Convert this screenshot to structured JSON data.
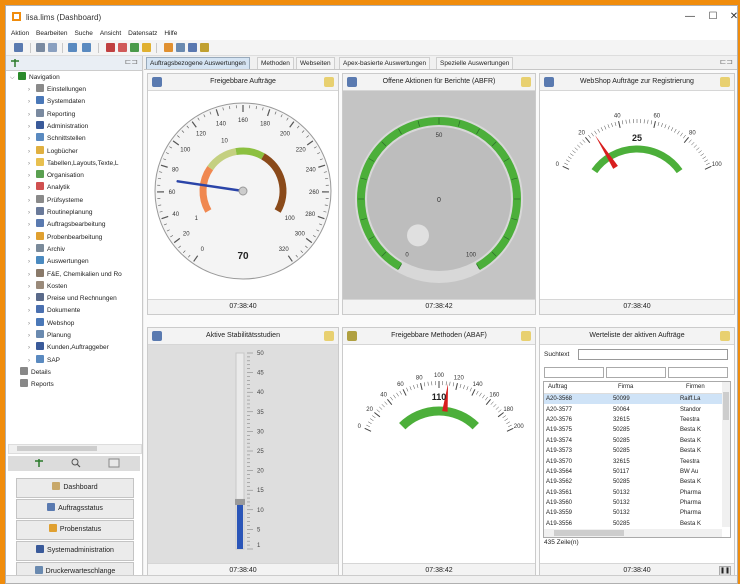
{
  "window": {
    "title": "lisa.lims (Dashboard)",
    "minimize": "—",
    "maximize": "☐",
    "close": "✕"
  },
  "menu": [
    "Aktion",
    "Bearbeiten",
    "Suche",
    "Ansicht",
    "Datensatz",
    "Hilfe"
  ],
  "toolbar_icons": [
    "save-icon",
    "print-icon",
    "search-icon",
    "window-icon",
    "window-icon",
    "table-icon",
    "table-icon",
    "edit-icon",
    "key-icon",
    "users-icon",
    "gear-icon",
    "book-icon"
  ],
  "tree": {
    "root": "Navigation",
    "items": [
      {
        "label": "Einstellungen",
        "icon": "wrench-icon",
        "color": "#8a8a8a"
      },
      {
        "label": "Systemdaten",
        "icon": "table-icon",
        "color": "#4a78b8"
      },
      {
        "label": "Reporting",
        "icon": "report-icon",
        "color": "#7a8aa0"
      },
      {
        "label": "Administration",
        "icon": "user-icon",
        "color": "#3a5a9a"
      },
      {
        "label": "Schnittstellen",
        "icon": "eye-icon",
        "color": "#5a8ac0"
      },
      {
        "label": "Logbücher",
        "icon": "book-icon",
        "color": "#e0b040"
      },
      {
        "label": "Tabellen,Layouts,Texte,L",
        "icon": "folder-icon",
        "color": "#e8c050"
      },
      {
        "label": "Organisation",
        "icon": "org-icon",
        "color": "#5aa050"
      },
      {
        "label": "Analytik",
        "icon": "flask-icon",
        "color": "#d05050"
      },
      {
        "label": "Prüfsysteme",
        "icon": "pipette-icon",
        "color": "#8a8a8a"
      },
      {
        "label": "Routineplanung",
        "icon": "calendar-icon",
        "color": "#6a7a9a"
      },
      {
        "label": "Auftragsbearbeitung",
        "icon": "order-icon",
        "color": "#5a7ab0"
      },
      {
        "label": "Probenbearbeitung",
        "icon": "hand-icon",
        "color": "#e0a030"
      },
      {
        "label": "Archiv",
        "icon": "archive-icon",
        "color": "#7a8a9a"
      },
      {
        "label": "Auswertungen",
        "icon": "chart-icon",
        "color": "#4a8ac0"
      },
      {
        "label": "F&E, Chemikalien und Ro",
        "icon": "chemical-icon",
        "color": "#8a7a6a"
      },
      {
        "label": "Kosten",
        "icon": "coins-icon",
        "color": "#9a8a7a"
      },
      {
        "label": "Preise und Rechnungen",
        "icon": "invoice-icon",
        "color": "#5a6a8a"
      },
      {
        "label": "Dokumente",
        "icon": "document-icon",
        "color": "#4a70b0"
      },
      {
        "label": "Webshop",
        "icon": "cart-icon",
        "color": "#4a78b8"
      },
      {
        "label": "Planung",
        "icon": "planning-icon",
        "color": "#6a8ab0"
      },
      {
        "label": "Kunden,Auftraggeber",
        "icon": "customer-icon",
        "color": "#3a5a9a"
      },
      {
        "label": "SAP",
        "icon": "sap-icon",
        "color": "#5a8ac0"
      }
    ],
    "extra": [
      {
        "label": "Details",
        "icon": "search-icon"
      },
      {
        "label": "Reports",
        "icon": "report-icon"
      }
    ]
  },
  "nav_buttons": [
    "Dashboard",
    "Auftragsstatus",
    "Probenstatus",
    "Systemadministration",
    "Druckerwarteschlange"
  ],
  "tabs": [
    "Auftragsbezogene Auswertungen",
    "Methoden",
    "Webseiten",
    "Apex-basierte Auswertungen",
    "Spezielle Auswertungen"
  ],
  "active_tab": 0,
  "panels": {
    "p1": {
      "title": "Freigebbare Aufträge",
      "time": "07:38:40"
    },
    "p2": {
      "title": "Offene Aktionen für Berichte (ABFR)",
      "time": "07:38:42"
    },
    "p3": {
      "title": "WebShop Aufträge zur Registrierung",
      "time": "07:38:40"
    },
    "p4": {
      "title": "Aktive Stabilitätsstudien",
      "time": "07:38:40"
    },
    "p5": {
      "title": "Freigebbare Methoden (ABAF)",
      "time": "07:38:42"
    },
    "p6": {
      "title": "Werteliste der aktiven Aufträge",
      "time": "07:38:40"
    }
  },
  "gauge1": {
    "value": 70,
    "value_label": "70",
    "min": 0,
    "max": 320,
    "ticks": [
      "0",
      "20",
      "40",
      "60",
      "80",
      "100",
      "120",
      "140",
      "160",
      "180",
      "200",
      "220",
      "240",
      "260",
      "280",
      "300",
      "320"
    ],
    "inner_ticks": [
      "1",
      "10",
      "100"
    ]
  },
  "gauge2": {
    "value": 0,
    "value_label": "0",
    "min": 0,
    "max": 100,
    "ticks": [
      "0",
      "50",
      "100"
    ]
  },
  "gauge3": {
    "value": 25,
    "value_label": "25",
    "min": 0,
    "max": 100,
    "ticks": [
      "0",
      "20",
      "40",
      "60",
      "80",
      "100"
    ]
  },
  "stability": {
    "value": 12,
    "min": 0,
    "max": 50,
    "ticks": [
      "50",
      "45",
      "40",
      "35",
      "30",
      "25",
      "20",
      "15",
      "10",
      "5",
      "1"
    ]
  },
  "gauge5": {
    "value": 110,
    "value_label": "110",
    "min": 0,
    "max": 200,
    "ticks": [
      "0",
      "20",
      "40",
      "60",
      "80",
      "100",
      "120",
      "140",
      "160",
      "180",
      "200"
    ]
  },
  "worklist": {
    "search_label": "Suchtext",
    "columns": [
      "Auftrag",
      "Firma",
      "Firmen"
    ],
    "rows": [
      [
        "A20-3568",
        "50099",
        "Raiff.La"
      ],
      [
        "A20-3577",
        "50064",
        "Standor"
      ],
      [
        "A20-3576",
        "32615",
        "Teestra"
      ],
      [
        "A19-3575",
        "50285",
        "Besta K"
      ],
      [
        "A19-3574",
        "50285",
        "Besta K"
      ],
      [
        "A19-3573",
        "50285",
        "Besta K"
      ],
      [
        "A19-3570",
        "32615",
        "Teestra"
      ],
      [
        "A19-3564",
        "50117",
        "BW Au"
      ],
      [
        "A19-3562",
        "50285",
        "Besta K"
      ],
      [
        "A19-3561",
        "50132",
        "Pharma"
      ],
      [
        "A19-3560",
        "50132",
        "Pharma"
      ],
      [
        "A19-3559",
        "50132",
        "Pharma"
      ],
      [
        "A19-3556",
        "50285",
        "Besta K"
      ]
    ],
    "count": "435 Zeile(n)"
  },
  "colors": {
    "accent": "#f08c0c",
    "green": "#4caf3a",
    "needle_red": "#d81e1e",
    "needle_blue": "#2a44a8"
  }
}
